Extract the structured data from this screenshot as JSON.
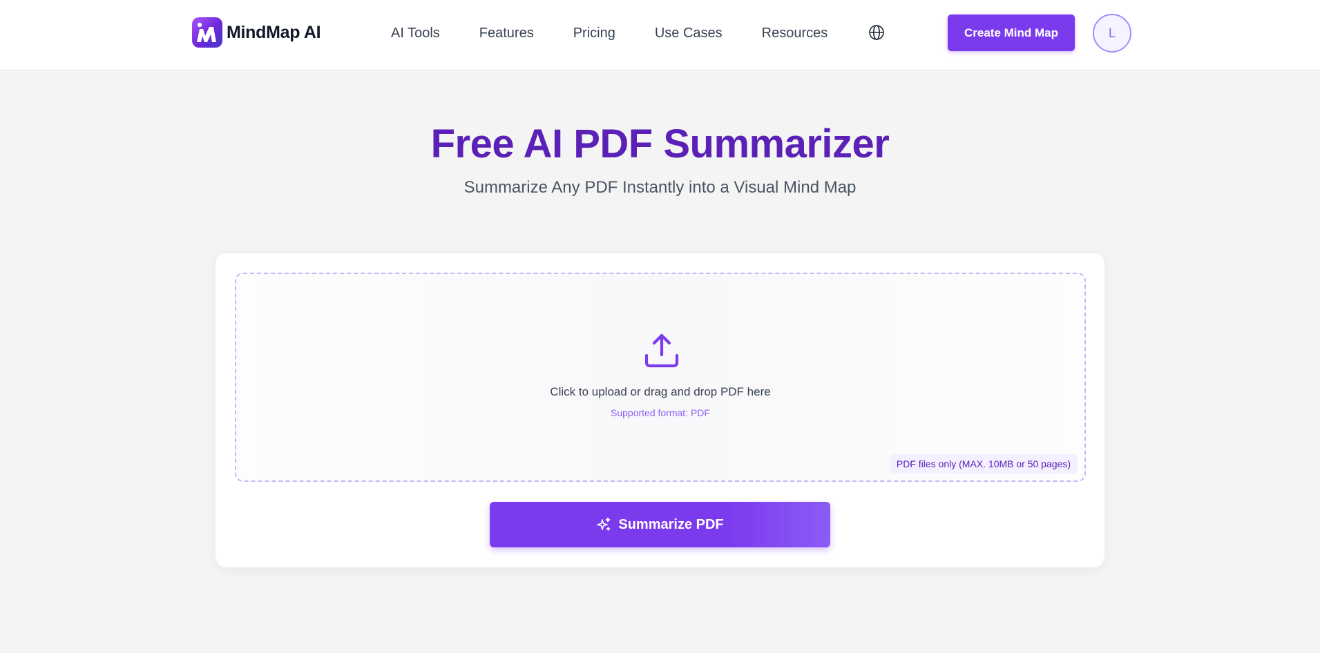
{
  "header": {
    "logo_text": "MindMap AI",
    "logo_icon": "mindmap-logo-icon",
    "nav": [
      {
        "label": "AI Tools"
      },
      {
        "label": "Features"
      },
      {
        "label": "Pricing"
      },
      {
        "label": "Use Cases"
      },
      {
        "label": "Resources"
      }
    ],
    "language_icon": "globe-icon",
    "cta_label": "Create Mind Map",
    "avatar_initial": "L"
  },
  "hero": {
    "title": "Free AI PDF Summarizer",
    "subtitle": "Summarize Any PDF Instantly into a Visual Mind Map"
  },
  "upload": {
    "icon": "upload-icon",
    "main_text": "Click to upload or drag and drop PDF here",
    "sub_text": "Supported format: PDF",
    "limit_text": "PDF files only (MAX. 10MB or 50 pages)"
  },
  "action": {
    "icon": "sparkle-icon",
    "label": "Summarize PDF"
  },
  "colors": {
    "accent": "#7c3aed",
    "title": "#5b21b6",
    "background": "#f4f4f5"
  }
}
